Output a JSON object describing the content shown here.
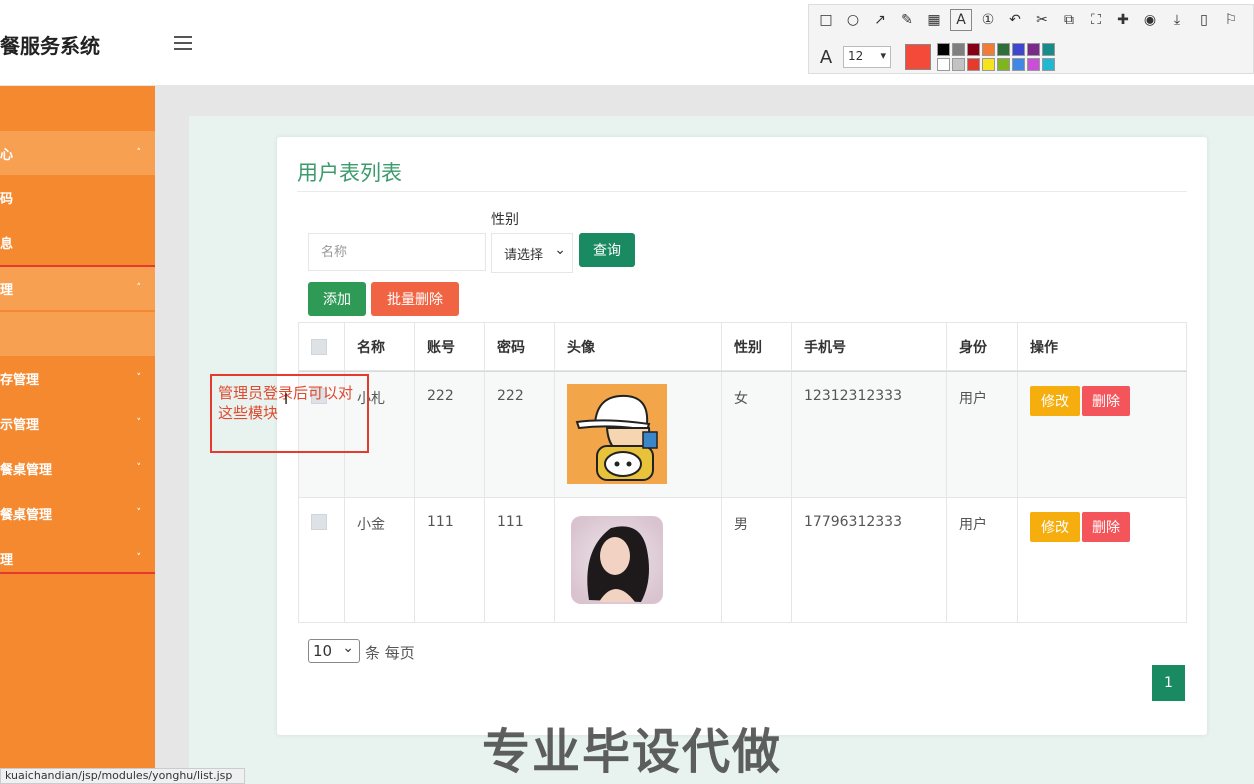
{
  "header": {
    "app_title": "餐服务系统"
  },
  "annotation_toolbar": {
    "tools": [
      "rect-icon",
      "ellipse-icon",
      "arrow-icon",
      "pencil-icon",
      "mosaic-icon",
      "text-icon",
      "number-icon",
      "undo-icon",
      "cut-icon",
      "ocr-icon",
      "screenshot-icon",
      "pin-icon",
      "record-icon",
      "download-icon",
      "save-icon",
      "bookmark-icon"
    ],
    "font_size": "12",
    "current_color": "#f44a3a",
    "palette": [
      "#000000",
      "#7f7f7f",
      "#880015",
      "#f27b36",
      "#2f6e3b",
      "#3f48cc",
      "#7a2a8a",
      "#178a8a",
      "#ffffff",
      "#c3c3c3",
      "#e53a2e",
      "#f6e31c",
      "#7fb61f",
      "#3f88e6",
      "#c94ed8",
      "#20b7d3"
    ]
  },
  "sidebar": {
    "items": [
      {
        "label": "心",
        "caret": "˄"
      },
      {
        "label": "码",
        "caret": ""
      },
      {
        "label": "息",
        "caret": ""
      },
      {
        "label": "理",
        "caret": "˄"
      },
      {
        "label": "存管理",
        "caret": "˅"
      },
      {
        "label": "示管理",
        "caret": "˅"
      },
      {
        "label": "餐桌管理",
        "caret": "˅"
      },
      {
        "label": "餐桌管理",
        "caret": "˅"
      },
      {
        "label": "理",
        "caret": "˅"
      }
    ]
  },
  "main": {
    "title": "用户表列表",
    "search": {
      "name_placeholder": "名称",
      "sex_label": "性别",
      "sex_value": "请选择",
      "query_label": "查询"
    },
    "actions": {
      "add_label": "添加",
      "batch_delete_label": "批量删除"
    },
    "table": {
      "headers": [
        "名称",
        "账号",
        "密码",
        "头像",
        "性别",
        "手机号",
        "身份",
        "操作"
      ],
      "rows": [
        {
          "name": "小札",
          "account": "222",
          "password": "222",
          "sex": "女",
          "phone": "12312312333",
          "role": "用户",
          "edit": "修改",
          "delete": "删除"
        },
        {
          "name": "小金",
          "account": "111",
          "password": "111",
          "sex": "男",
          "phone": "17796312333",
          "role": "用户",
          "edit": "修改",
          "delete": "删除"
        }
      ]
    },
    "pagination": {
      "page_size": "10",
      "per_page_text": "条 每页",
      "current_page": "1"
    }
  },
  "annotation_note": "管理员登录后可以对这些模块",
  "watermark": "专业毕设代做",
  "status_url": "kuaichandian/jsp/modules/yonghu/list.jsp"
}
